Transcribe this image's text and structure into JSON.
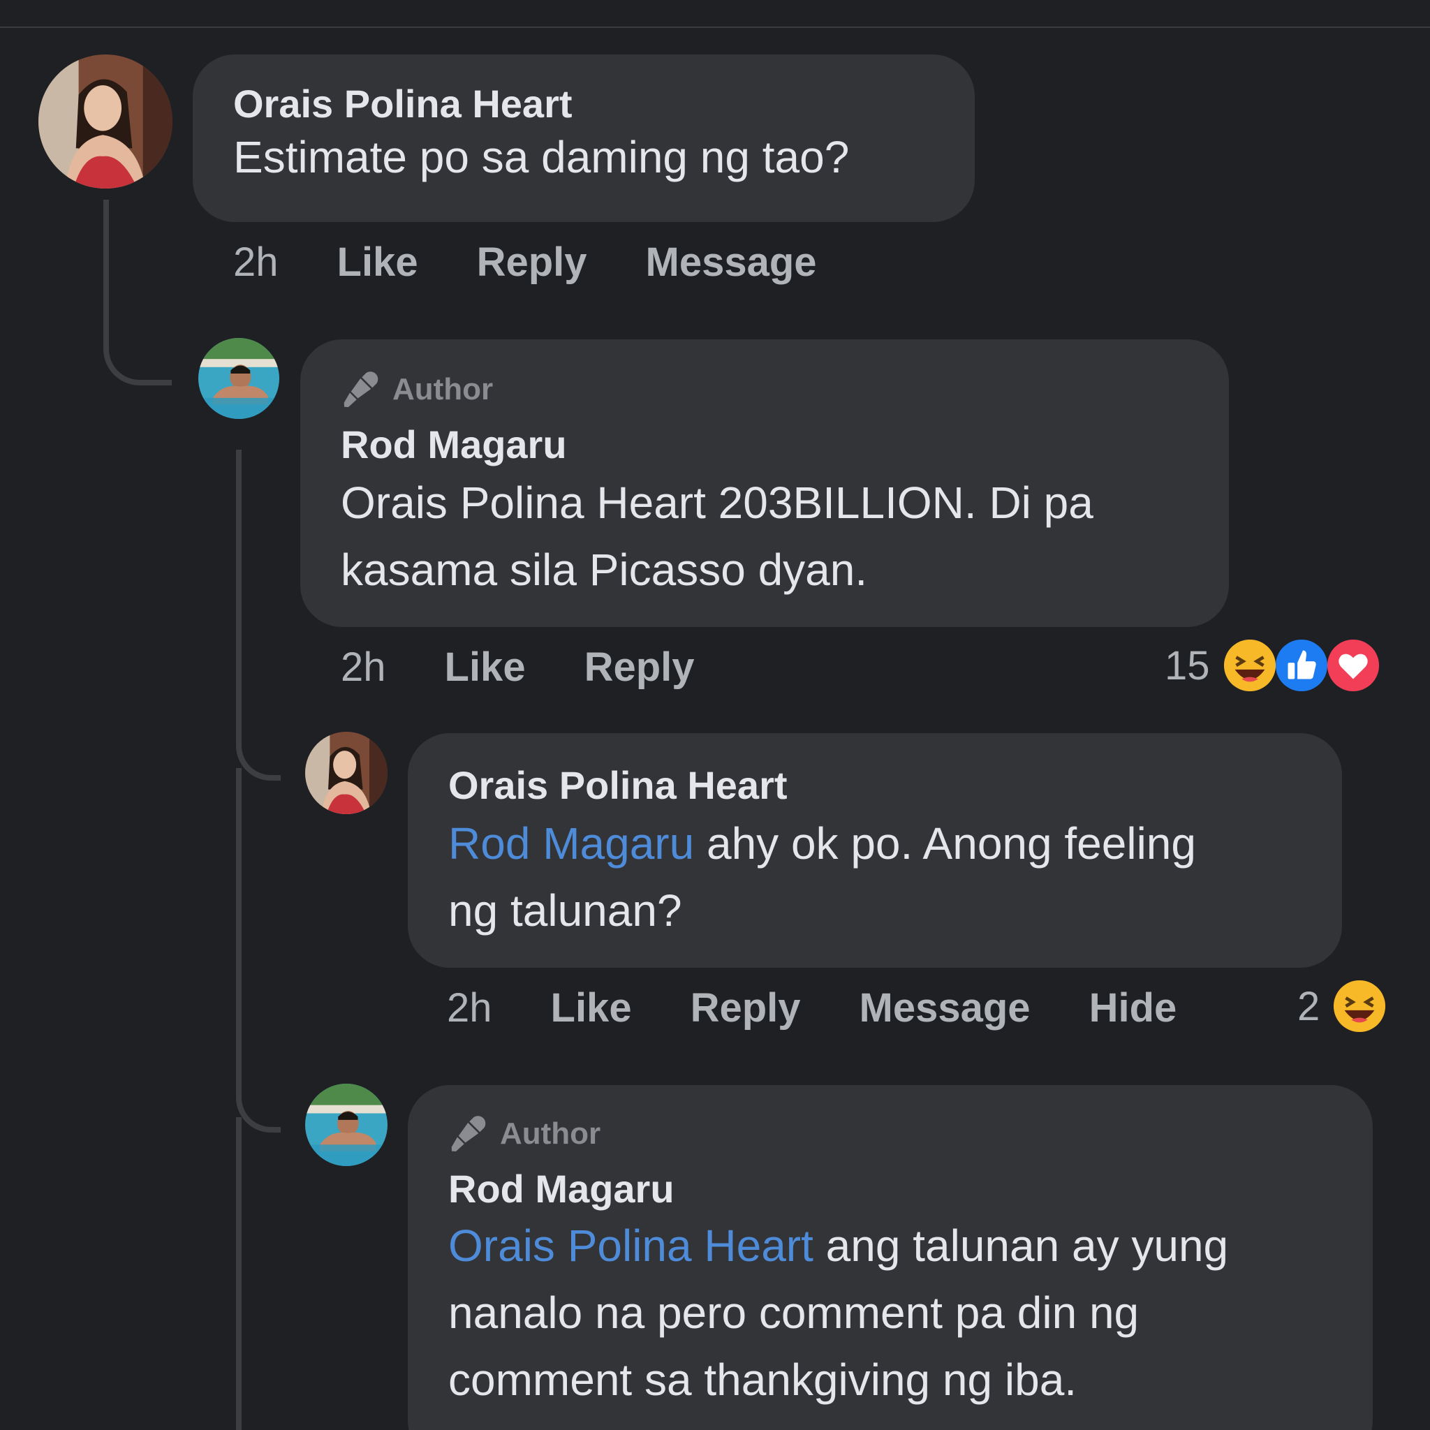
{
  "comments": [
    {
      "author": "Orais Polina Heart",
      "is_author": false,
      "text": "Estimate po sa daming ng tao?",
      "time": "2h",
      "actions": [
        "Like",
        "Reply",
        "Message"
      ]
    },
    {
      "author": "Rod Magaru",
      "is_author": true,
      "badge": "Author",
      "text_line1": "Orais Polina Heart 203BILLION. Di pa",
      "text_line2": "kasama sila Picasso dyan.",
      "time": "2h",
      "actions": [
        "Like",
        "Reply"
      ],
      "reaction_count": "15",
      "reaction_icons": [
        "haha-icon",
        "like-icon",
        "love-icon"
      ]
    },
    {
      "author": "Orais Polina Heart",
      "is_author": false,
      "mention": "Rod Magaru",
      "text_line1_rest": " ahy ok po. Anong feeling",
      "text_line2": "ng talunan?",
      "time": "2h",
      "actions": [
        "Like",
        "Reply",
        "Message",
        "Hide"
      ],
      "reaction_count": "2",
      "reaction_icons": [
        "haha-icon"
      ]
    },
    {
      "author": "Rod Magaru",
      "is_author": true,
      "badge": "Author",
      "mention": "Orais Polina Heart",
      "text_line1_rest": " ang talunan ay yung",
      "text_line2": "nanalo na pero comment pa din ng",
      "text_line3": "comment sa thankgiving ng iba."
    }
  ],
  "colors": {
    "background": "#1f2023",
    "bubble": "#333437",
    "mention": "#4e8bd8",
    "secondary_text": "#b0b3b8"
  }
}
